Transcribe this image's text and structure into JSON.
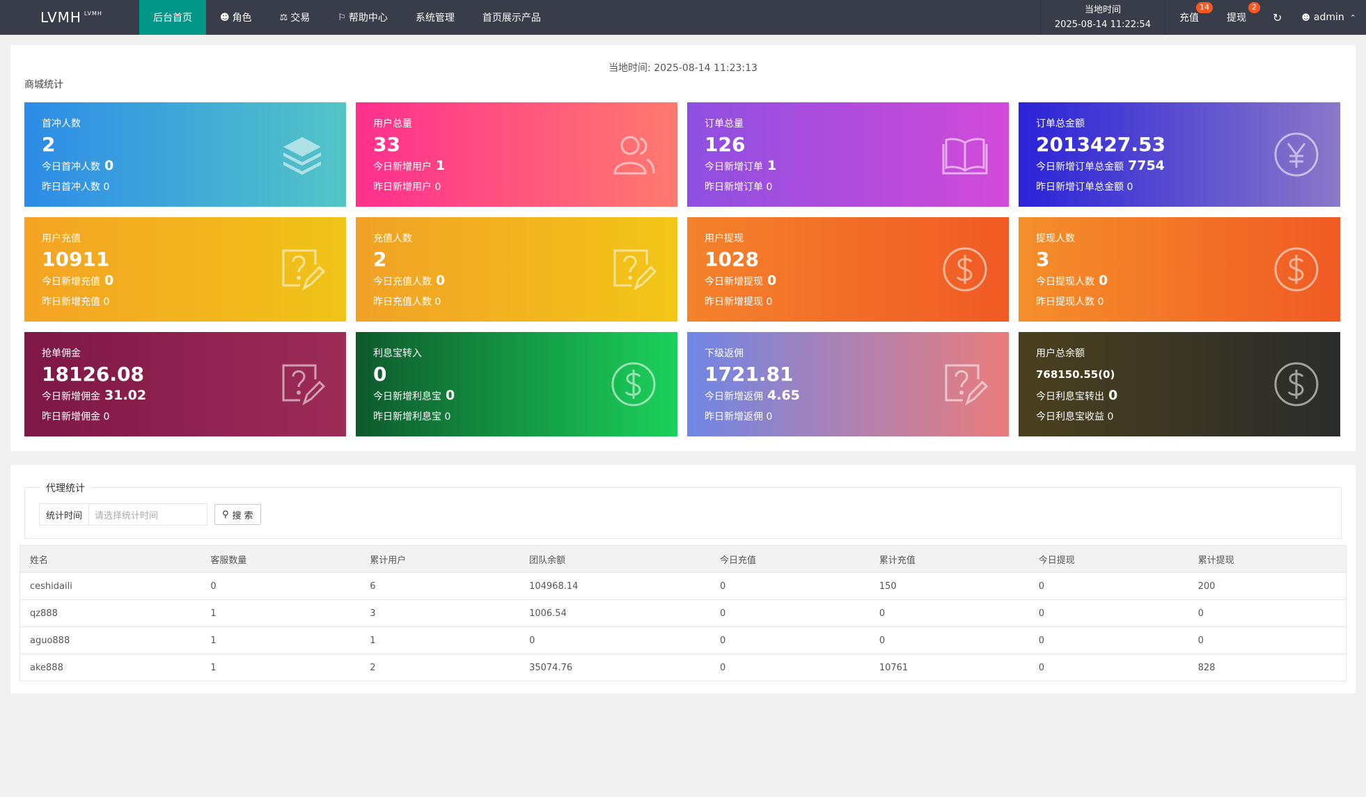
{
  "header": {
    "logo": "LVMH",
    "logo_sup": "LVMH",
    "nav": [
      {
        "label": "后台首页",
        "icon": "",
        "active": true
      },
      {
        "label": "角色",
        "icon": "user-icon"
      },
      {
        "label": "交易",
        "icon": "scale-icon"
      },
      {
        "label": "帮助中心",
        "icon": "flag-icon"
      },
      {
        "label": "系统管理",
        "icon": ""
      },
      {
        "label": "首页展示产品",
        "icon": ""
      }
    ],
    "time_label": "当地时间",
    "time_value": "2025-08-14 11:22:54",
    "recharge_label": "充值",
    "recharge_badge": "14",
    "withdraw_label": "提现",
    "withdraw_badge": "2",
    "user_name": "admin"
  },
  "stats": {
    "local_time": "当地时间:  2025-08-14 11:23:13",
    "section_title": "商城统计",
    "cards": [
      {
        "title": "首冲人数",
        "value": "2",
        "sub1_label": "今日首冲人数",
        "sub1_value": "0",
        "sub2": "昨日首冲人数  0",
        "icon": "layers-icon"
      },
      {
        "title": "用户总量",
        "value": "33",
        "sub1_label": "今日新增用户",
        "sub1_value": "1",
        "sub2": "昨日新增用户  0",
        "icon": "users-icon"
      },
      {
        "title": "订单总量",
        "value": "126",
        "sub1_label": "今日新增订单",
        "sub1_value": "1",
        "sub2": "昨日新增订单  0",
        "icon": "book-icon"
      },
      {
        "title": "订单总金额",
        "value": "2013427.53",
        "sub1_label": "今日新增订单总金额",
        "sub1_value": "7754",
        "sub2": "昨日新增订单总金额  0",
        "icon": "yen-icon"
      },
      {
        "title": "用户充值",
        "value": "10911",
        "sub1_label": "今日新增充值",
        "sub1_value": "0",
        "sub2": "昨日新增充值  0",
        "icon": "question-edit-icon"
      },
      {
        "title": "充值人数",
        "value": "2",
        "sub1_label": "今日充值人数",
        "sub1_value": "0",
        "sub2": "昨日充值人数  0",
        "icon": "question-edit-icon"
      },
      {
        "title": "用户提现",
        "value": "1028",
        "sub1_label": "今日新增提现",
        "sub1_value": "0",
        "sub2": "昨日新增提现  0",
        "icon": "dollar-icon"
      },
      {
        "title": "提现人数",
        "value": "3",
        "sub1_label": "今日提现人数",
        "sub1_value": "0",
        "sub2": "昨日提现人数  0",
        "icon": "dollar-icon"
      },
      {
        "title": "抢单佣金",
        "value": "18126.08",
        "sub1_label": "今日新增佣金",
        "sub1_value": "31.02",
        "sub2": "昨日新增佣金  0",
        "icon": "question-edit-icon"
      },
      {
        "title": "利息宝转入",
        "value": "0",
        "sub1_label": "今日新增利息宝",
        "sub1_value": "0",
        "sub2": "昨日新增利息宝  0",
        "icon": "dollar-icon"
      },
      {
        "title": "下级返佣",
        "value": "1721.81",
        "sub1_label": "今日新增返佣",
        "sub1_value": "4.65",
        "sub2": "昨日新增返佣  0",
        "icon": "question-edit-icon"
      },
      {
        "title": "用户总余额",
        "value": "768150.55(0)",
        "sub1_label": "今日利息宝转出",
        "sub1_value": "0",
        "sub2": "今日利息宝收益  0",
        "icon": "dollar-icon"
      }
    ],
    "gradients": [
      [
        "#2d8ce8",
        "#52c5c6"
      ],
      [
        "#ff2f8e",
        "#ff7a6e"
      ],
      [
        "#8e4fe0",
        "#d24ad9"
      ],
      [
        "#2a23d8",
        "#8a78c8"
      ],
      [
        "#f4a323",
        "#f0c418"
      ],
      [
        "#f1a126",
        "#f2c617"
      ],
      [
        "#f4822b",
        "#f05a24"
      ],
      [
        "#f58f2a",
        "#f05a24"
      ],
      [
        "#7e1746",
        "#9d2c57"
      ],
      [
        "#0e5a2c",
        "#1bd15b"
      ],
      [
        "#6f86e6",
        "#ea7d7d"
      ],
      [
        "#4a401d",
        "#2a2c2c"
      ]
    ]
  },
  "agent": {
    "legend": "代理统计",
    "time_label": "统计时间",
    "time_placeholder": "请选择统计时间",
    "search_label": "搜 索",
    "columns": [
      "姓名",
      "客服数量",
      "累计用户",
      "团队余额",
      "今日充值",
      "累计充值",
      "今日提现",
      "累计提现"
    ],
    "rows": [
      [
        "ceshidaili",
        "0",
        "6",
        "104968.14",
        "0",
        "150",
        "0",
        "200"
      ],
      [
        "qz888",
        "1",
        "3",
        "1006.54",
        "0",
        "0",
        "0",
        "0"
      ],
      [
        "aguo888",
        "1",
        "1",
        "0",
        "0",
        "0",
        "0",
        "0"
      ],
      [
        "ake888",
        "1",
        "2",
        "35074.76",
        "0",
        "10761",
        "0",
        "828"
      ]
    ]
  }
}
